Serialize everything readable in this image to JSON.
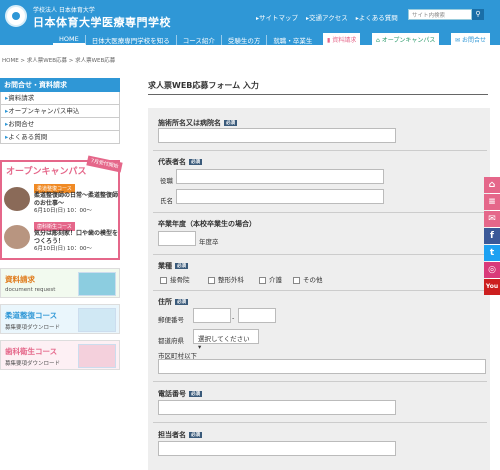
{
  "header": {
    "corp": "学校法人 日本体育大学",
    "school": "日本体育大学医療専門学校"
  },
  "topnav": [
    "サイトマップ",
    "交通アクセス",
    "よくある質問"
  ],
  "search": {
    "placeholder": "サイト内検索"
  },
  "mainnav": [
    "HOME",
    "日体大医療専門学校を知る",
    "コース紹介",
    "受験生の方",
    "就職・卒業生"
  ],
  "hbtns": {
    "request": "資料請求",
    "opencampus": "オープンキャンパス",
    "contact": "お問合せ"
  },
  "breadcrumb": "HOME > 求人票WEB応募 > 求人票WEB応募",
  "sidebar": {
    "title": "お問合せ・資料請求",
    "items": [
      "資料請求",
      "オープンキャンパス申込",
      "お問合せ",
      "よくある質問"
    ]
  },
  "oc": {
    "banner": "7月受付開始",
    "title": "オープンキャンパス",
    "events": [
      {
        "badge": "柔道整復コース",
        "text": "柔道整復師の日常～柔道整復師のお仕事～",
        "date": "6月10日(日) 10：00～",
        "color": "#f08a24"
      },
      {
        "badge": "歯科衛生コース",
        "text": "気分は彫刻家！口や歯の模型をつくろう！",
        "date": "6月10日(日) 10：00～",
        "color": "#e5678a"
      }
    ]
  },
  "banners": [
    {
      "title": "資料請求",
      "sub": "document request",
      "color": "#e07a1a"
    },
    {
      "title": "柔道整復コース",
      "sub": "募集要項ダウンロード",
      "color": "#2f97d6"
    },
    {
      "title": "歯科衛生コース",
      "sub": "募集要項ダウンロード",
      "color": "#e5678a"
    }
  ],
  "form": {
    "title": "求人票WEB応募フォーム 入力",
    "req": "必須",
    "facility": "施術所名又は病院名",
    "rep": "代表者名",
    "post": "役職",
    "name": "氏名",
    "year": "卒業年度（本校卒業生の場合）",
    "year_unit": "年度卒",
    "industry": "業種",
    "ind_opts": [
      "接骨院",
      "整形外科",
      "介護",
      "その他"
    ],
    "address": "住所",
    "zip": "郵便番号",
    "zip_dash": "-",
    "pref": "都道府県",
    "pref_sel": "選択してください",
    "city": "市区町村以下",
    "tel": "電話番号",
    "contact": "担当者名"
  },
  "social": [
    {
      "name": "opencampus-icon",
      "color": "#e5678a",
      "glyph": "⌂"
    },
    {
      "name": "document-icon",
      "color": "#e5678a",
      "glyph": "≡"
    },
    {
      "name": "mail-icon",
      "color": "#e5678a",
      "glyph": "✉"
    },
    {
      "name": "facebook-icon",
      "color": "#3b5998",
      "glyph": "f"
    },
    {
      "name": "twitter-icon",
      "color": "#1da1f2",
      "glyph": "t"
    },
    {
      "name": "instagram-icon",
      "color": "#d93a7a",
      "glyph": "◎"
    },
    {
      "name": "youtube-icon",
      "color": "#cc1f1f",
      "glyph": "You"
    }
  ]
}
